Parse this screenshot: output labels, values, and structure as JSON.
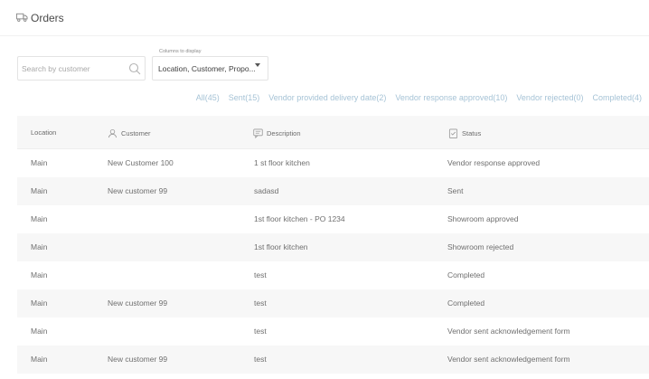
{
  "header": {
    "title": "Orders",
    "icon": "truck-icon"
  },
  "search": {
    "placeholder": "Search by customer",
    "value": ""
  },
  "columns_select": {
    "label": "Columns to display",
    "value": "Location, Customer, Propo..."
  },
  "filters": [
    {
      "label": "All(45)"
    },
    {
      "label": "Sent(15)"
    },
    {
      "label": "Vendor provided delivery date(2)"
    },
    {
      "label": "Vendor response approved(10)"
    },
    {
      "label": "Vendor rejected(0)"
    },
    {
      "label": "Completed(4)"
    }
  ],
  "table": {
    "headers": {
      "location": "Location",
      "customer": "Customer",
      "description": "Description",
      "status": "Status"
    },
    "rows": [
      {
        "location": "Main",
        "customer": "New Customer 100",
        "description": "1 st floor kitchen",
        "status": "Vendor response approved"
      },
      {
        "location": "Main",
        "customer": "New customer 99",
        "description": "sadasd",
        "status": "Sent"
      },
      {
        "location": "Main",
        "customer": "",
        "description": "1st floor kitchen - PO 1234",
        "status": "Showroom approved"
      },
      {
        "location": "Main",
        "customer": "",
        "description": "1st floor kitchen",
        "status": "Showroom rejected"
      },
      {
        "location": "Main",
        "customer": "",
        "description": "test",
        "status": "Completed"
      },
      {
        "location": "Main",
        "customer": "New customer 99",
        "description": "test",
        "status": "Completed"
      },
      {
        "location": "Main",
        "customer": "",
        "description": "test",
        "status": "Vendor sent acknowledgement form"
      },
      {
        "location": "Main",
        "customer": "New customer 99",
        "description": "test",
        "status": "Vendor sent acknowledgement form"
      }
    ]
  },
  "colors": {
    "filter_link": "#a6c3d6",
    "row_alt": "#f7f7f7",
    "text": "#6f6f6f"
  }
}
